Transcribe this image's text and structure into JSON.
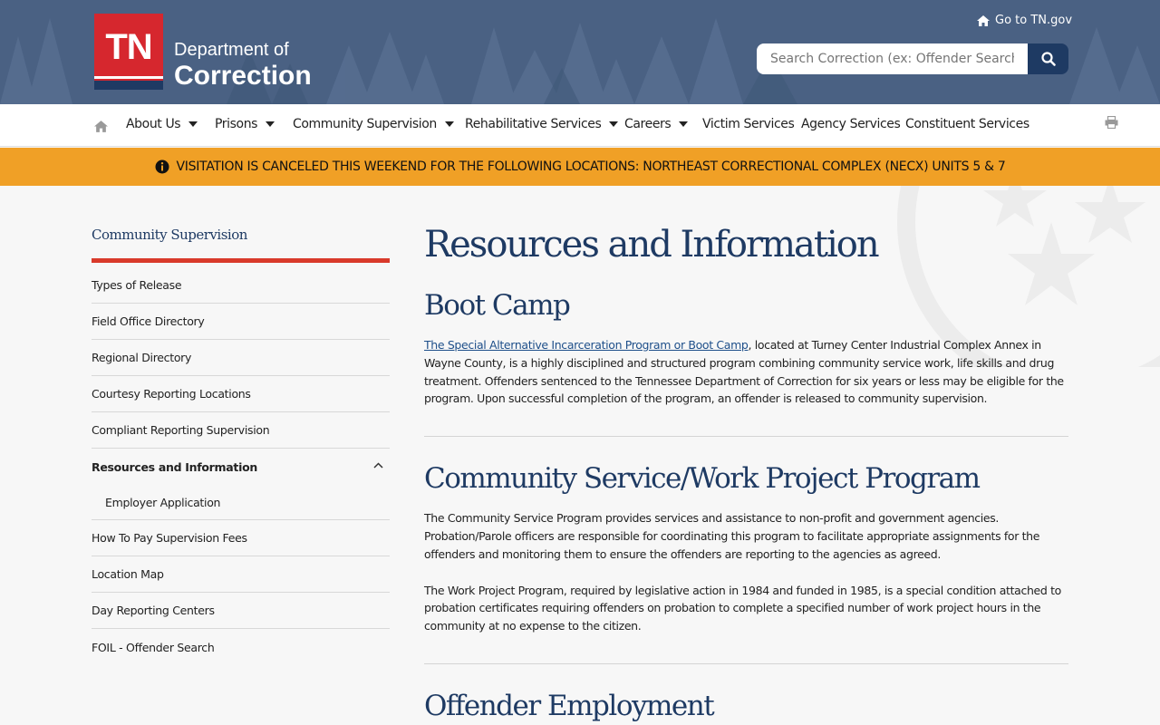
{
  "header": {
    "logo_mark": "TN",
    "dept_line1": "Department of",
    "dept_line2": "Correction",
    "goto_label": "Go to TN.gov",
    "search_placeholder": "Search Correction (ex: Offender Search)"
  },
  "nav": {
    "items": [
      {
        "label": "About Us",
        "dropdown": true
      },
      {
        "label": "Prisons",
        "dropdown": true
      },
      {
        "label": "Community Supervision",
        "dropdown": true
      },
      {
        "label": "Rehabilitative Services",
        "dropdown": true
      },
      {
        "label": "Careers",
        "dropdown": true
      },
      {
        "label": "Victim Services",
        "dropdown": false
      },
      {
        "label": "Agency Services",
        "dropdown": false
      },
      {
        "label": "Constituent Services",
        "dropdown": false
      }
    ]
  },
  "alert": {
    "text": "VISITATION IS CANCELED THIS WEEKEND FOR THE FOLLOWING LOCATIONS: NORTHEAST CORRECTIONAL COMPLEX (NECX) UNITS 5 & 7",
    "color": "#f0a026"
  },
  "sidebar": {
    "title": "Community Supervision",
    "items": [
      {
        "label": "Types of Release"
      },
      {
        "label": "Field Office Directory"
      },
      {
        "label": "Regional Directory"
      },
      {
        "label": "Courtesy Reporting Locations"
      },
      {
        "label": "Compliant Reporting Supervision"
      },
      {
        "label": "Resources and Information"
      },
      {
        "label": "Employer Application"
      },
      {
        "label": "How To Pay Supervision Fees"
      },
      {
        "label": "Location Map"
      },
      {
        "label": "Day Reporting Centers"
      },
      {
        "label": "FOIL - Offender Search"
      }
    ]
  },
  "main": {
    "title": "Resources and Information",
    "sections": [
      {
        "heading": "Boot Camp",
        "link_text": "The Special Alternative Incarceration Program or Boot Camp",
        "paragraph": ", located at Turney Center Industrial Complex Annex in Wayne County, is a highly disciplined and structured program combining community service work, life skills and drug treatment. Offenders sentenced to the Tennessee Department of Correction for six years or less may be eligible for the program. Upon successful completion of the program, an offender is released to community supervision."
      },
      {
        "heading": "Community Service/Work Project Program",
        "paragraph1": "The Community Service Program provides services and assistance to non-profit and government agencies. Probation/Parole officers are responsible for coordinating this program to facilitate appropriate assignments for the offenders and monitoring them to ensure the offenders are reporting to the agencies as agreed.",
        "paragraph2": "The Work Project Program, required by legislative action in 1984 and funded in 1985, is a special condition attached to probation certificates requiring offenders on probation to complete a specified number of work project hours in the community at no expense to the citizen."
      },
      {
        "heading": "Offender Employment"
      }
    ]
  },
  "colors": {
    "navy": "#1e3a63",
    "header_bg": "#4a6183",
    "accent_red": "#d93a2b"
  }
}
